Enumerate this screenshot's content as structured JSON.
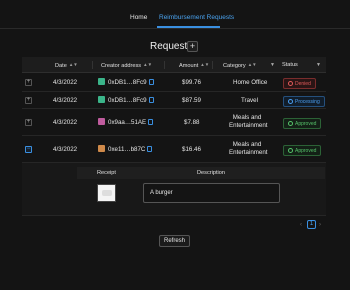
{
  "nav": {
    "tabs": [
      {
        "label": "Home"
      },
      {
        "label": "Reimbursement Requests"
      }
    ]
  },
  "page": {
    "title": "Requests",
    "add_label": "+"
  },
  "table": {
    "headers": {
      "date": "Date",
      "creator": "Creator address",
      "amount": "Amount",
      "category": "Category",
      "status": "Status"
    },
    "rows": [
      {
        "date": "4/3/2022",
        "creator": "0xDB1…8Fc9",
        "amount": "$99.76",
        "category": "Home Office",
        "status": "Denied",
        "avatar_color": "#3bb58a"
      },
      {
        "date": "4/3/2022",
        "creator": "0xDB1…8Fc9",
        "amount": "$87.59",
        "category": "Travel",
        "status": "Processing",
        "avatar_color": "#3bb58a"
      },
      {
        "date": "4/3/2022",
        "creator": "0x9aa…51AE",
        "amount": "$7.88",
        "category": "Meals and Entertainment",
        "status": "Approved",
        "avatar_color": "#c05c9e"
      },
      {
        "date": "4/3/2022",
        "creator": "0xe11…b87C",
        "amount": "$16.46",
        "category": "Meals and Entertainment",
        "status": "Approved",
        "avatar_color": "#d08a4a"
      }
    ],
    "detail": {
      "receipt_header": "Receipt",
      "description_header": "Description",
      "description": "A burger"
    }
  },
  "pager": {
    "prev": "‹",
    "current_page": "1",
    "next": "›"
  },
  "refresh_label": "Refresh",
  "colors": {
    "accent": "#3a8fe0",
    "denied": "#e05a5a",
    "processing": "#4a9ef0",
    "approved": "#56c26a"
  }
}
